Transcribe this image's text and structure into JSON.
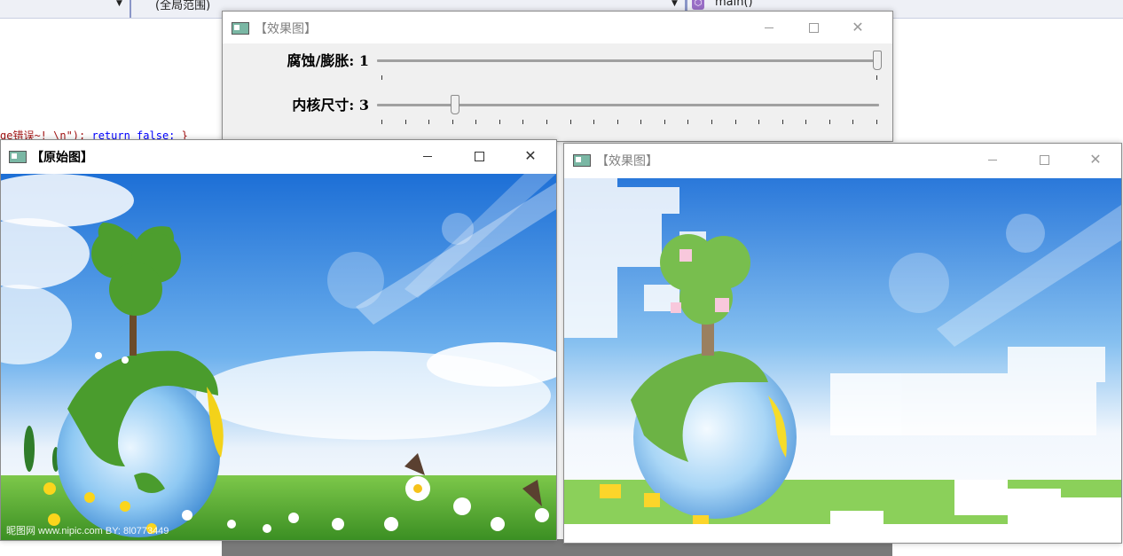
{
  "ide": {
    "scope_combo": "(全局范围)",
    "function_combo": "main()",
    "code_fragment_a": "ge错误~! \\n\"); ",
    "code_fragment_kw": "return false;",
    "code_fragment_b": " }"
  },
  "windows": {
    "trackbar_window": {
      "title": "【效果图】",
      "trackbars": [
        {
          "label": "腐蚀/膨胀: 1",
          "value": 1,
          "max": 1
        },
        {
          "label": "内核尺寸: 3",
          "value": 3,
          "max": 21
        }
      ]
    },
    "original_window": {
      "title": "【原始图】"
    },
    "effect_window": {
      "title": "【效果图】"
    }
  },
  "watermark": "昵图网 www.nipic.com  BY: 8l0773449"
}
